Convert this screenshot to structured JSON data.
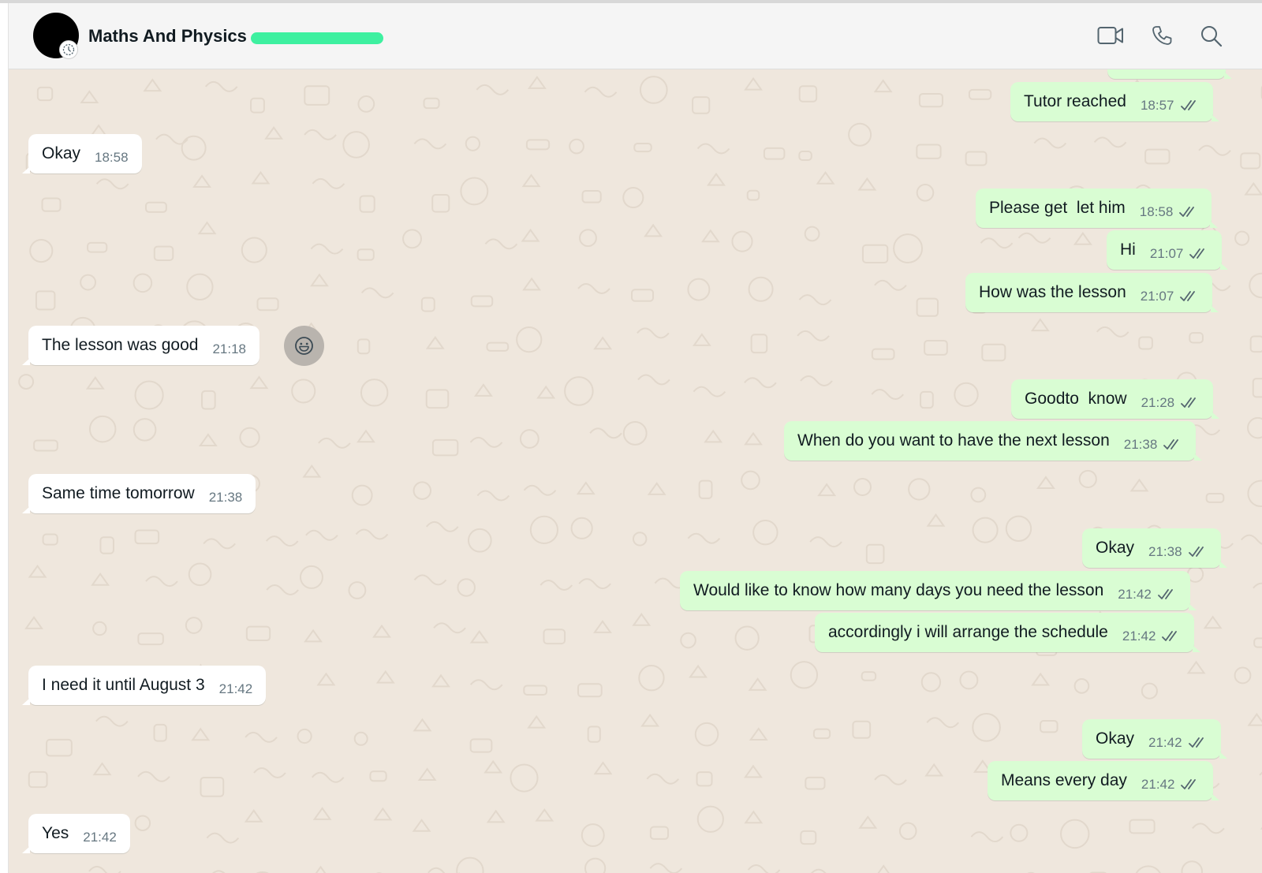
{
  "header": {
    "title": "Maths And Physics",
    "avatar_icon": "group-avatar-icon",
    "avatar_badge_icon": "community-clock-icon",
    "actions": [
      "video-call-icon",
      "voice-call-icon",
      "search-icon"
    ]
  },
  "colors": {
    "outgoing_bubble": "#d9fdd3",
    "incoming_bubble": "#ffffff",
    "chat_background": "#efe7dd",
    "header_background": "#f5f5f5",
    "redaction_mark": "#3ef0a0"
  },
  "messages": [
    {
      "direction": "out",
      "text": "",
      "time": "",
      "status": "read"
    },
    {
      "direction": "out",
      "text": "Tutor reached",
      "time": "18:57",
      "status": "read"
    },
    {
      "direction": "in",
      "text": "Okay",
      "time": "18:58"
    },
    {
      "direction": "out",
      "text": "Please get  let him",
      "time": "18:58",
      "status": "read"
    },
    {
      "direction": "out",
      "text": "Hi",
      "time": "21:07",
      "status": "read"
    },
    {
      "direction": "out",
      "text": "How was the lesson",
      "time": "21:07",
      "status": "read"
    },
    {
      "direction": "in",
      "text": "The lesson was good",
      "time": "21:18"
    },
    {
      "direction": "out",
      "text": "Goodto  know",
      "time": "21:28",
      "status": "read"
    },
    {
      "direction": "out",
      "text": "When do you want to have the next lesson",
      "time": "21:38",
      "status": "read"
    },
    {
      "direction": "in",
      "text": "Same time tomorrow",
      "time": "21:38"
    },
    {
      "direction": "out",
      "text": "Okay",
      "time": "21:38",
      "status": "read"
    },
    {
      "direction": "out",
      "text": "Would like to know how many days you need the lesson",
      "time": "21:42",
      "status": "read"
    },
    {
      "direction": "out",
      "text": "accordingly i will arrange the schedule",
      "time": "21:42",
      "status": "read"
    },
    {
      "direction": "in",
      "text": "I need it until August 3",
      "time": "21:42"
    },
    {
      "direction": "out",
      "text": "Okay",
      "time": "21:42",
      "status": "read"
    },
    {
      "direction": "out",
      "text": "Means every day",
      "time": "21:42",
      "status": "read"
    },
    {
      "direction": "in",
      "text": "Yes",
      "time": "21:42"
    }
  ],
  "reaction_button_icon": "emoji-react-icon"
}
